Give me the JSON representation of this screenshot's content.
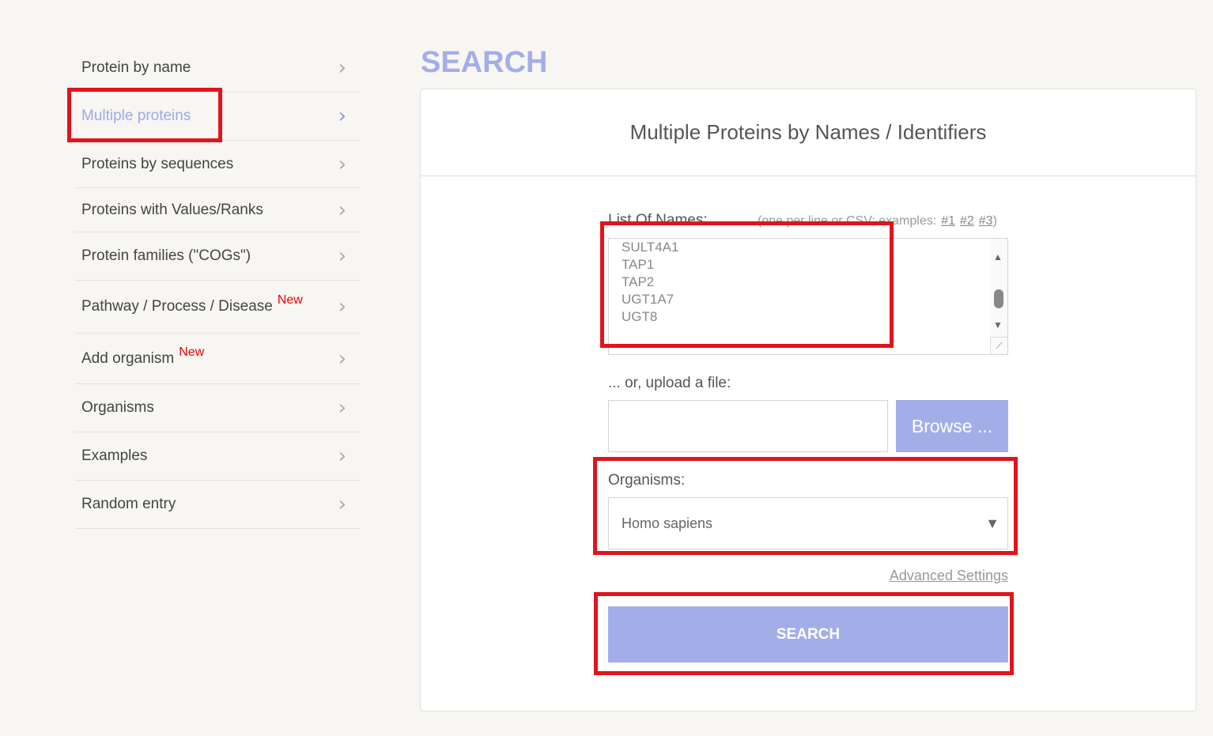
{
  "sidebar": {
    "items": [
      {
        "label": "Protein by name"
      },
      {
        "label": "Multiple proteins",
        "active": true
      },
      {
        "label": "Proteins by sequences"
      },
      {
        "label": "Proteins with Values/Ranks"
      },
      {
        "label": "Protein families (\"COGs\")"
      },
      {
        "label": "Pathway / Process / Disease",
        "badge": "New"
      },
      {
        "label": "Add organism",
        "badge": "New"
      },
      {
        "label": "Organisms"
      },
      {
        "label": "Examples"
      },
      {
        "label": "Random entry"
      }
    ]
  },
  "page_title": "SEARCH",
  "panel": {
    "heading": "Multiple Proteins by Names / Identifiers",
    "list_label": "List Of Names:",
    "hint": "(one per line or CSV; examples:",
    "examples": [
      "#1",
      "#2",
      "#3"
    ],
    "hint_end": ")",
    "names": [
      "SULT4A1",
      "TAP1",
      "TAP2",
      "UGT1A7",
      "UGT8"
    ],
    "upload_label": "... or, upload a file:",
    "browse": "Browse ...",
    "organisms_label": "Organisms:",
    "organism": "Homo sapiens",
    "advanced": "Advanced Settings",
    "search": "SEARCH"
  },
  "colors": {
    "accent": "#a3aee8",
    "highlight": "#e0141c"
  }
}
